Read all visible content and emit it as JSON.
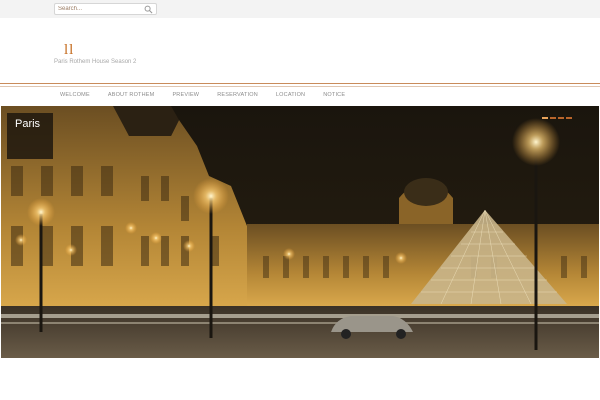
{
  "search": {
    "placeholder": "Search..."
  },
  "site": {
    "logo": "ll",
    "tagline": "Paris Rothem House Season 2"
  },
  "nav": {
    "items": [
      "Welcome",
      "About Rothem",
      "Preview",
      "Reservation",
      "Location",
      "Notice"
    ]
  },
  "slider": {
    "caption": "Paris",
    "slide_count": 4,
    "active_slide": 1
  },
  "colors": {
    "accent": "#c46a1c",
    "divider": "#c98b5b",
    "caption_bg": "#1e180e"
  }
}
